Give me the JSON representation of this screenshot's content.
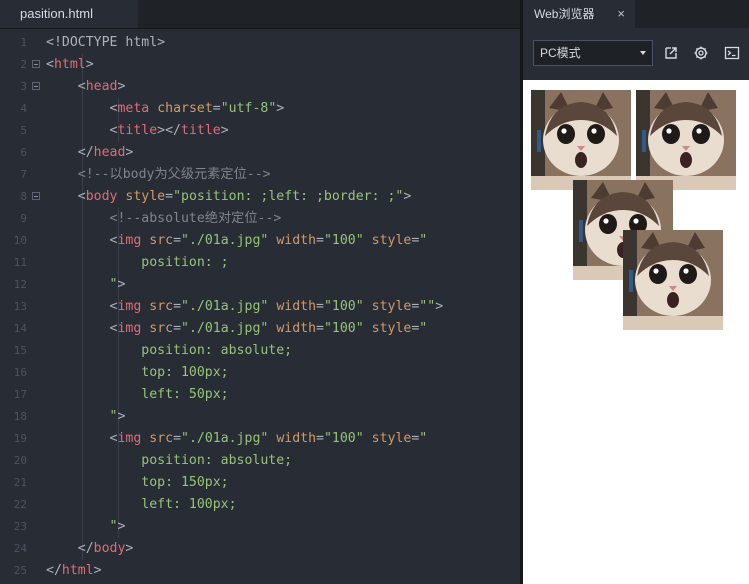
{
  "editor": {
    "tab_title": "pasition.html",
    "lines": [
      {
        "n": "1",
        "segs": [
          {
            "c": "pl",
            "t": "<!DOCTYPE html>"
          }
        ]
      },
      {
        "n": "2",
        "segs": [
          {
            "c": "pl",
            "t": "<"
          },
          {
            "c": "tag",
            "t": "html"
          },
          {
            "c": "pl",
            "t": ">"
          }
        ]
      },
      {
        "n": "3",
        "segs": [
          {
            "c": "pl",
            "t": "    <"
          },
          {
            "c": "tag",
            "t": "head"
          },
          {
            "c": "pl",
            "t": ">"
          }
        ]
      },
      {
        "n": "4",
        "segs": [
          {
            "c": "pl",
            "t": "        <"
          },
          {
            "c": "tag",
            "t": "meta"
          },
          {
            "c": "pl",
            "t": " "
          },
          {
            "c": "attr",
            "t": "charset"
          },
          {
            "c": "pl",
            "t": "="
          },
          {
            "c": "str",
            "t": "\"utf-8\""
          },
          {
            "c": "pl",
            "t": ">"
          }
        ]
      },
      {
        "n": "5",
        "segs": [
          {
            "c": "pl",
            "t": "        <"
          },
          {
            "c": "tag",
            "t": "title"
          },
          {
            "c": "pl",
            "t": "></"
          },
          {
            "c": "tag",
            "t": "title"
          },
          {
            "c": "pl",
            "t": ">"
          }
        ]
      },
      {
        "n": "6",
        "segs": [
          {
            "c": "pl",
            "t": "    </"
          },
          {
            "c": "tag",
            "t": "head"
          },
          {
            "c": "pl",
            "t": ">"
          }
        ]
      },
      {
        "n": "7",
        "segs": [
          {
            "c": "cm",
            "t": "    <!--以body为父级元素定位-->"
          }
        ]
      },
      {
        "n": "8",
        "segs": [
          {
            "c": "pl",
            "t": "    <"
          },
          {
            "c": "tag",
            "t": "body"
          },
          {
            "c": "pl",
            "t": " "
          },
          {
            "c": "attr",
            "t": "style"
          },
          {
            "c": "pl",
            "t": "="
          },
          {
            "c": "str",
            "t": "\"position: ;left: ;border: ;\""
          },
          {
            "c": "pl",
            "t": ">"
          }
        ]
      },
      {
        "n": "9",
        "segs": [
          {
            "c": "cm",
            "t": "        <!--absolute绝对定位-->"
          }
        ]
      },
      {
        "n": "10",
        "segs": [
          {
            "c": "pl",
            "t": "        <"
          },
          {
            "c": "tag",
            "t": "img"
          },
          {
            "c": "pl",
            "t": " "
          },
          {
            "c": "attr",
            "t": "src"
          },
          {
            "c": "pl",
            "t": "="
          },
          {
            "c": "str",
            "t": "\"./01a.jpg\""
          },
          {
            "c": "pl",
            "t": " "
          },
          {
            "c": "attr",
            "t": "width"
          },
          {
            "c": "pl",
            "t": "="
          },
          {
            "c": "str",
            "t": "\"100\""
          },
          {
            "c": "pl",
            "t": " "
          },
          {
            "c": "attr",
            "t": "style"
          },
          {
            "c": "pl",
            "t": "="
          },
          {
            "c": "str",
            "t": "\""
          }
        ]
      },
      {
        "n": "11",
        "segs": [
          {
            "c": "str",
            "t": "            position: ;"
          }
        ]
      },
      {
        "n": "12",
        "segs": [
          {
            "c": "str",
            "t": "        \""
          },
          {
            "c": "pl",
            "t": ">"
          }
        ]
      },
      {
        "n": "13",
        "segs": [
          {
            "c": "pl",
            "t": "        <"
          },
          {
            "c": "tag",
            "t": "img"
          },
          {
            "c": "pl",
            "t": " "
          },
          {
            "c": "attr",
            "t": "src"
          },
          {
            "c": "pl",
            "t": "="
          },
          {
            "c": "str",
            "t": "\"./01a.jpg\""
          },
          {
            "c": "pl",
            "t": " "
          },
          {
            "c": "attr",
            "t": "width"
          },
          {
            "c": "pl",
            "t": "="
          },
          {
            "c": "str",
            "t": "\"100\""
          },
          {
            "c": "pl",
            "t": " "
          },
          {
            "c": "attr",
            "t": "style"
          },
          {
            "c": "pl",
            "t": "="
          },
          {
            "c": "str",
            "t": "\"\""
          },
          {
            "c": "pl",
            "t": ">"
          }
        ]
      },
      {
        "n": "14",
        "segs": [
          {
            "c": "pl",
            "t": "        <"
          },
          {
            "c": "tag",
            "t": "img"
          },
          {
            "c": "pl",
            "t": " "
          },
          {
            "c": "attr",
            "t": "src"
          },
          {
            "c": "pl",
            "t": "="
          },
          {
            "c": "str",
            "t": "\"./01a.jpg\""
          },
          {
            "c": "pl",
            "t": " "
          },
          {
            "c": "attr",
            "t": "width"
          },
          {
            "c": "pl",
            "t": "="
          },
          {
            "c": "str",
            "t": "\"100\""
          },
          {
            "c": "pl",
            "t": " "
          },
          {
            "c": "attr",
            "t": "style"
          },
          {
            "c": "pl",
            "t": "="
          },
          {
            "c": "str",
            "t": "\""
          }
        ]
      },
      {
        "n": "15",
        "segs": [
          {
            "c": "str",
            "t": "            position: absolute;"
          }
        ]
      },
      {
        "n": "16",
        "segs": [
          {
            "c": "str",
            "t": "            top: 100px;"
          }
        ]
      },
      {
        "n": "17",
        "segs": [
          {
            "c": "str",
            "t": "            left: 50px;"
          }
        ]
      },
      {
        "n": "18",
        "segs": [
          {
            "c": "str",
            "t": "        \""
          },
          {
            "c": "pl",
            "t": ">"
          }
        ]
      },
      {
        "n": "19",
        "segs": [
          {
            "c": "pl",
            "t": "        <"
          },
          {
            "c": "tag",
            "t": "img"
          },
          {
            "c": "pl",
            "t": " "
          },
          {
            "c": "attr",
            "t": "src"
          },
          {
            "c": "pl",
            "t": "="
          },
          {
            "c": "str",
            "t": "\"./01a.jpg\""
          },
          {
            "c": "pl",
            "t": " "
          },
          {
            "c": "attr",
            "t": "width"
          },
          {
            "c": "pl",
            "t": "="
          },
          {
            "c": "str",
            "t": "\"100\""
          },
          {
            "c": "pl",
            "t": " "
          },
          {
            "c": "attr",
            "t": "style"
          },
          {
            "c": "pl",
            "t": "="
          },
          {
            "c": "str",
            "t": "\""
          }
        ]
      },
      {
        "n": "20",
        "segs": [
          {
            "c": "str",
            "t": "            position: absolute;"
          }
        ]
      },
      {
        "n": "21",
        "segs": [
          {
            "c": "str",
            "t": "            top: 150px;"
          }
        ]
      },
      {
        "n": "22",
        "segs": [
          {
            "c": "str",
            "t": "            left: 100px;"
          }
        ]
      },
      {
        "n": "23",
        "segs": [
          {
            "c": "str",
            "t": "        \""
          },
          {
            "c": "pl",
            "t": ">"
          }
        ]
      },
      {
        "n": "24",
        "segs": [
          {
            "c": "pl",
            "t": "    </"
          },
          {
            "c": "tag",
            "t": "body"
          },
          {
            "c": "pl",
            "t": ">"
          }
        ]
      },
      {
        "n": "25",
        "segs": [
          {
            "c": "pl",
            "t": "</"
          },
          {
            "c": "tag",
            "t": "html"
          },
          {
            "c": "pl",
            "t": ">"
          }
        ]
      }
    ],
    "fold_lines": [
      "2",
      "3",
      "8"
    ]
  },
  "browser": {
    "tab_title": "Web浏览器",
    "close_glyph": "×",
    "mode_select_value": "PC模式",
    "toolbar_icons": [
      "expand-icon",
      "gear-icon",
      "console-icon"
    ],
    "image_count": 4
  },
  "colors": {
    "tag": "#e06c75",
    "attribute": "#d19a66",
    "string": "#98c379",
    "comment": "#7f848e",
    "editor_bg": "#282c34",
    "browser_bg": "#ffffff"
  }
}
